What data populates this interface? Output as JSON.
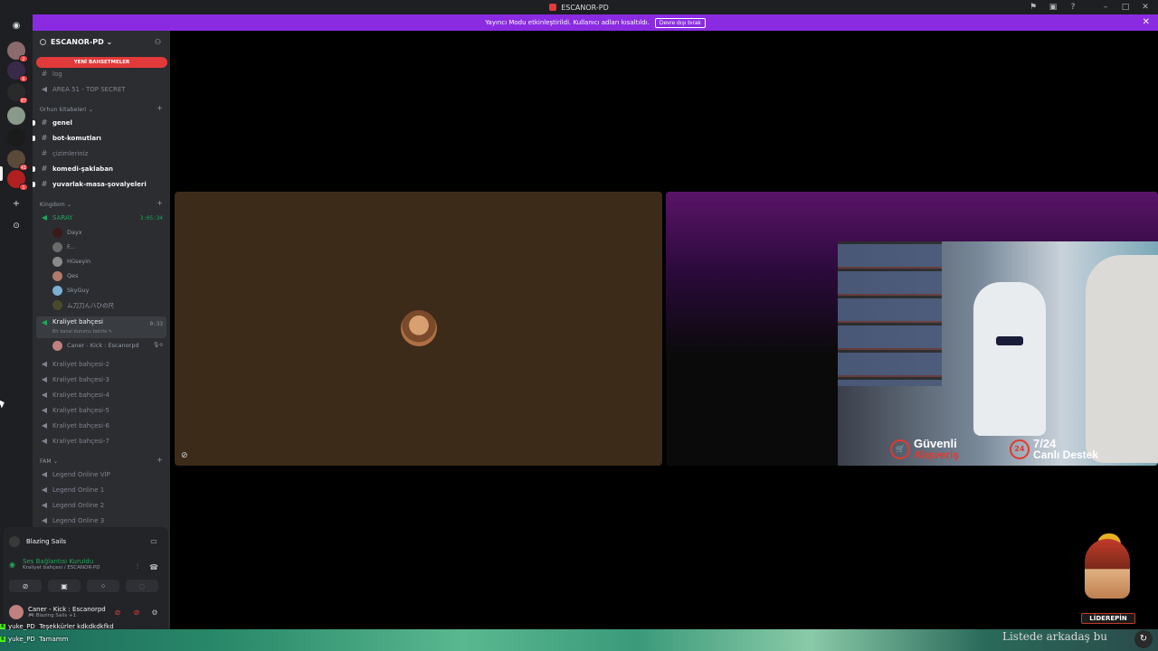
{
  "window": {
    "title": "ESCANOR-PD"
  },
  "notice": {
    "text": "Yayıncı Modu etkinleştirildi. Kullanıcı adları kısaltıldı.",
    "button": "Devre dışı bırak"
  },
  "guild": {
    "name": "ESCANOR-PD ⌄",
    "mentions_pill": "YENİ BAHSETMELER"
  },
  "channels_top": [
    {
      "name": "log",
      "type": "text",
      "unread": false
    },
    {
      "name": "AREA 51 - TOP SECRET",
      "type": "voice",
      "unread": false
    }
  ],
  "category_orhun": {
    "name": "Orhun kitabeleri ⌄"
  },
  "channels_orhun": [
    {
      "name": "genel",
      "unread": true
    },
    {
      "name": "bot-komutları",
      "unread": true
    },
    {
      "name": "çizimleriniz",
      "unread": false
    },
    {
      "name": "komedi-şaklaban",
      "unread": true
    },
    {
      "name": "yuvarlak-masa-şovalyeleri",
      "unread": true
    }
  ],
  "category_kingdom": {
    "name": "Kingdom ⌄"
  },
  "voice_saray": {
    "name": "SARAY",
    "timer": "3:05:34"
  },
  "saray_users": [
    "Dayx",
    "F...",
    "Hüseyin",
    "Qes",
    "SkyGuy",
    "ム刀刀ん八ひの尺"
  ],
  "voice_kraliyet": {
    "name": "Kraliyet bahçesi",
    "timer": "0:33",
    "status": "Bir kanal durumu belirle ✎"
  },
  "kraliyet_users": [
    "Caner - Kick : Escanorpd"
  ],
  "voice_others": [
    "Kraliyet bahçesi-2",
    "Kraliyet bahçesi-3",
    "Kraliyet bahçesi-4",
    "Kraliyet bahçesi-5",
    "Kraliyet bahçesi-6",
    "Kraliyet bahçesi-7"
  ],
  "category_fam": {
    "name": "FAM ⌄"
  },
  "voice_fam": [
    "Legend Online VİP",
    "Legend Online 1",
    "Legend Online 2",
    "Legend Online 3"
  ],
  "panel": {
    "activity": "Blazing Sails",
    "connection_title": "Ses Bağlantısı Kuruldu",
    "connection_sub": "Kraliyet bahçesi / ESCANOR-PD",
    "user_name": "Caner - Kick : Escanorpd",
    "user_status": "🎮 Blazing Sails +1"
  },
  "server_badges": [
    "2",
    "6",
    "87",
    "41",
    "1"
  ],
  "promo": {
    "left_line1": "Güvenli",
    "left_line2": "Alışveriş",
    "right_badge": "24",
    "right_line1": "7/24",
    "right_line2": "Canlı Destek"
  },
  "chat": [
    {
      "user": "yuke_PD",
      "text": "Teşekkürler kdkdkdkfkd"
    },
    {
      "user": "yuke_PD",
      "text": "Tamamm"
    }
  ],
  "ticker": "Listede arkadaş bu",
  "brand": {
    "label": "LİDEREPİN"
  },
  "colors": {
    "notice": "#8a2be2",
    "mentions": "#e23a3a",
    "online": "#23a55a",
    "promo_red": "#e03a2f"
  },
  "icons": {
    "voice": "speaker-icon",
    "text": "hash-icon"
  }
}
